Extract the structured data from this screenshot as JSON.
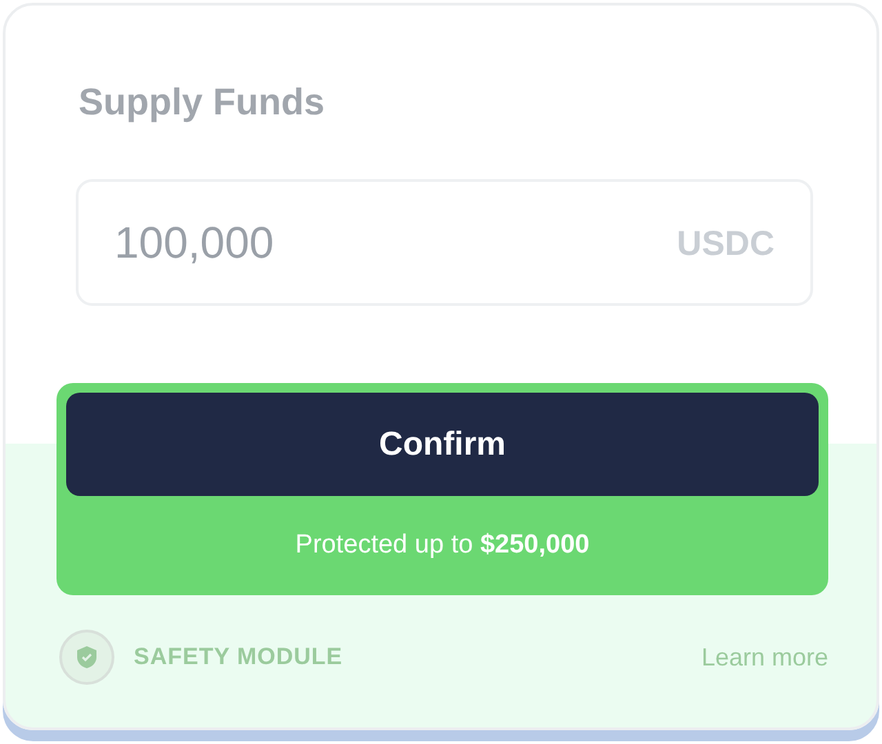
{
  "title": "Supply Funds",
  "amount_field": {
    "value": "100,000",
    "unit": "USDC"
  },
  "confirm_button": {
    "label": "Confirm"
  },
  "protection_note": "Protected up to **$250,000**",
  "footer": {
    "label": "SAFETY MODULE",
    "link": "Learn more"
  }
}
